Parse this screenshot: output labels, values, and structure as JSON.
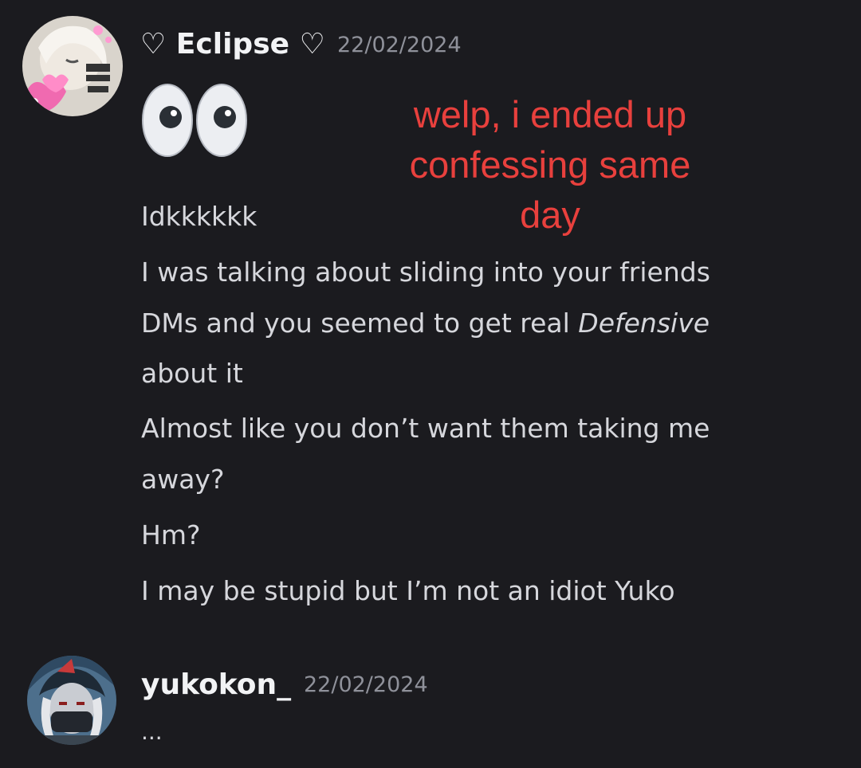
{
  "messages": [
    {
      "username": "♡ Eclipse ♡",
      "timestamp": "22/02/2024",
      "avatar": "anime-girl-avatar-with-pink-hearts",
      "emoji": "eyes-emoji",
      "lines": [
        "Idkkkkkk",
        "I was talking about sliding into your friends",
        "DMs and you seemed to get real ",
        "Defensive",
        "about it",
        "Almost like you don’t want them taking me",
        "away?",
        "Hm?",
        "I may be stupid but I’m not an idiot Yuko"
      ]
    },
    {
      "username": "yukokon_",
      "timestamp": "22/02/2024",
      "avatar": "masked-anime-character-avatar",
      "lines": [
        "..."
      ]
    }
  ],
  "overlay": {
    "lines": [
      "welp, i ended up",
      "confessing same",
      "day"
    ],
    "color": "#e8403d"
  },
  "colors": {
    "background": "#1b1b1f",
    "username": "#f2f3f5",
    "timestamp": "#8f919a",
    "message_text": "#d6d7dc"
  }
}
